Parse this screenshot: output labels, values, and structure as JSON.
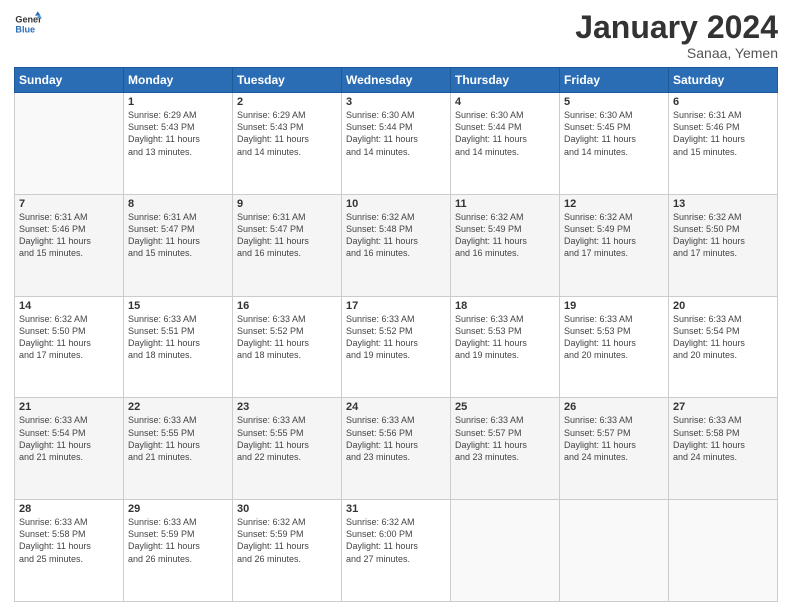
{
  "logo": {
    "line1": "General",
    "line2": "Blue"
  },
  "title": "January 2024",
  "subtitle": "Sanaa, Yemen",
  "header_days": [
    "Sunday",
    "Monday",
    "Tuesday",
    "Wednesday",
    "Thursday",
    "Friday",
    "Saturday"
  ],
  "weeks": [
    [
      {
        "day": "",
        "info": ""
      },
      {
        "day": "1",
        "info": "Sunrise: 6:29 AM\nSunset: 5:43 PM\nDaylight: 11 hours\nand 13 minutes."
      },
      {
        "day": "2",
        "info": "Sunrise: 6:29 AM\nSunset: 5:43 PM\nDaylight: 11 hours\nand 14 minutes."
      },
      {
        "day": "3",
        "info": "Sunrise: 6:30 AM\nSunset: 5:44 PM\nDaylight: 11 hours\nand 14 minutes."
      },
      {
        "day": "4",
        "info": "Sunrise: 6:30 AM\nSunset: 5:44 PM\nDaylight: 11 hours\nand 14 minutes."
      },
      {
        "day": "5",
        "info": "Sunrise: 6:30 AM\nSunset: 5:45 PM\nDaylight: 11 hours\nand 14 minutes."
      },
      {
        "day": "6",
        "info": "Sunrise: 6:31 AM\nSunset: 5:46 PM\nDaylight: 11 hours\nand 15 minutes."
      }
    ],
    [
      {
        "day": "7",
        "info": "Sunrise: 6:31 AM\nSunset: 5:46 PM\nDaylight: 11 hours\nand 15 minutes."
      },
      {
        "day": "8",
        "info": "Sunrise: 6:31 AM\nSunset: 5:47 PM\nDaylight: 11 hours\nand 15 minutes."
      },
      {
        "day": "9",
        "info": "Sunrise: 6:31 AM\nSunset: 5:47 PM\nDaylight: 11 hours\nand 16 minutes."
      },
      {
        "day": "10",
        "info": "Sunrise: 6:32 AM\nSunset: 5:48 PM\nDaylight: 11 hours\nand 16 minutes."
      },
      {
        "day": "11",
        "info": "Sunrise: 6:32 AM\nSunset: 5:49 PM\nDaylight: 11 hours\nand 16 minutes."
      },
      {
        "day": "12",
        "info": "Sunrise: 6:32 AM\nSunset: 5:49 PM\nDaylight: 11 hours\nand 17 minutes."
      },
      {
        "day": "13",
        "info": "Sunrise: 6:32 AM\nSunset: 5:50 PM\nDaylight: 11 hours\nand 17 minutes."
      }
    ],
    [
      {
        "day": "14",
        "info": "Sunrise: 6:32 AM\nSunset: 5:50 PM\nDaylight: 11 hours\nand 17 minutes."
      },
      {
        "day": "15",
        "info": "Sunrise: 6:33 AM\nSunset: 5:51 PM\nDaylight: 11 hours\nand 18 minutes."
      },
      {
        "day": "16",
        "info": "Sunrise: 6:33 AM\nSunset: 5:52 PM\nDaylight: 11 hours\nand 18 minutes."
      },
      {
        "day": "17",
        "info": "Sunrise: 6:33 AM\nSunset: 5:52 PM\nDaylight: 11 hours\nand 19 minutes."
      },
      {
        "day": "18",
        "info": "Sunrise: 6:33 AM\nSunset: 5:53 PM\nDaylight: 11 hours\nand 19 minutes."
      },
      {
        "day": "19",
        "info": "Sunrise: 6:33 AM\nSunset: 5:53 PM\nDaylight: 11 hours\nand 20 minutes."
      },
      {
        "day": "20",
        "info": "Sunrise: 6:33 AM\nSunset: 5:54 PM\nDaylight: 11 hours\nand 20 minutes."
      }
    ],
    [
      {
        "day": "21",
        "info": "Sunrise: 6:33 AM\nSunset: 5:54 PM\nDaylight: 11 hours\nand 21 minutes."
      },
      {
        "day": "22",
        "info": "Sunrise: 6:33 AM\nSunset: 5:55 PM\nDaylight: 11 hours\nand 21 minutes."
      },
      {
        "day": "23",
        "info": "Sunrise: 6:33 AM\nSunset: 5:55 PM\nDaylight: 11 hours\nand 22 minutes."
      },
      {
        "day": "24",
        "info": "Sunrise: 6:33 AM\nSunset: 5:56 PM\nDaylight: 11 hours\nand 23 minutes."
      },
      {
        "day": "25",
        "info": "Sunrise: 6:33 AM\nSunset: 5:57 PM\nDaylight: 11 hours\nand 23 minutes."
      },
      {
        "day": "26",
        "info": "Sunrise: 6:33 AM\nSunset: 5:57 PM\nDaylight: 11 hours\nand 24 minutes."
      },
      {
        "day": "27",
        "info": "Sunrise: 6:33 AM\nSunset: 5:58 PM\nDaylight: 11 hours\nand 24 minutes."
      }
    ],
    [
      {
        "day": "28",
        "info": "Sunrise: 6:33 AM\nSunset: 5:58 PM\nDaylight: 11 hours\nand 25 minutes."
      },
      {
        "day": "29",
        "info": "Sunrise: 6:33 AM\nSunset: 5:59 PM\nDaylight: 11 hours\nand 26 minutes."
      },
      {
        "day": "30",
        "info": "Sunrise: 6:32 AM\nSunset: 5:59 PM\nDaylight: 11 hours\nand 26 minutes."
      },
      {
        "day": "31",
        "info": "Sunrise: 6:32 AM\nSunset: 6:00 PM\nDaylight: 11 hours\nand 27 minutes."
      },
      {
        "day": "",
        "info": ""
      },
      {
        "day": "",
        "info": ""
      },
      {
        "day": "",
        "info": ""
      }
    ]
  ]
}
